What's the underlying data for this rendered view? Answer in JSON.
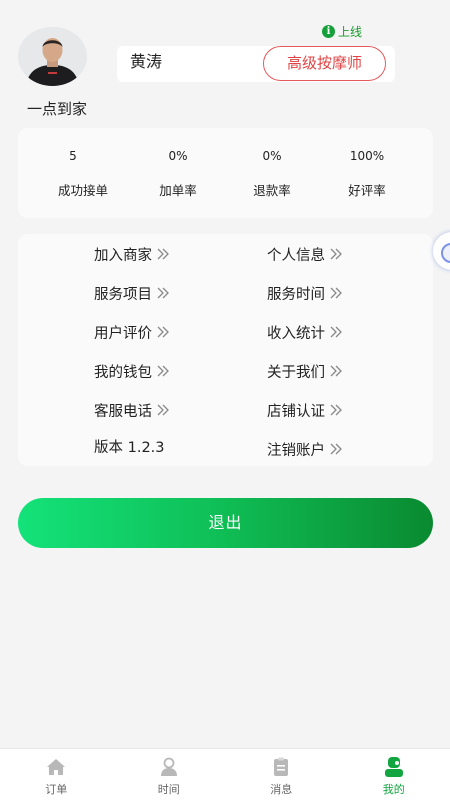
{
  "profile": {
    "online_status": "上线",
    "name": "黄涛",
    "title": "高级按摩师",
    "brand": "一点到家"
  },
  "stats": [
    {
      "value": "5",
      "label": "成功接单"
    },
    {
      "value": "0%",
      "label": "加单率"
    },
    {
      "value": "0%",
      "label": "退款率"
    },
    {
      "value": "100%",
      "label": "好评率"
    }
  ],
  "menu": {
    "join_merchant": "加入商家",
    "personal_info": "个人信息",
    "service_items": "服务项目",
    "service_time": "服务时间",
    "user_reviews": "用户评价",
    "income_stats": "收入统计",
    "my_wallet": "我的钱包",
    "about_us": "关于我们",
    "support_phone": "客服电话",
    "shop_verify": "店铺认证",
    "version": "版本 1.2.3",
    "delete_account": "注销账户"
  },
  "logout_label": "退出",
  "bottom_nav": [
    {
      "label": "订单",
      "icon": "home-icon",
      "active": false
    },
    {
      "label": "时间",
      "icon": "person-icon",
      "active": false
    },
    {
      "label": "消息",
      "icon": "clipboard-icon",
      "active": false
    },
    {
      "label": "我的",
      "icon": "profile-icon",
      "active": true
    }
  ],
  "colors": {
    "accent_green": "#13a640",
    "badge_red": "#e45a5a",
    "button_gradient_start": "#14e27a",
    "button_gradient_end": "#0a8a30"
  }
}
